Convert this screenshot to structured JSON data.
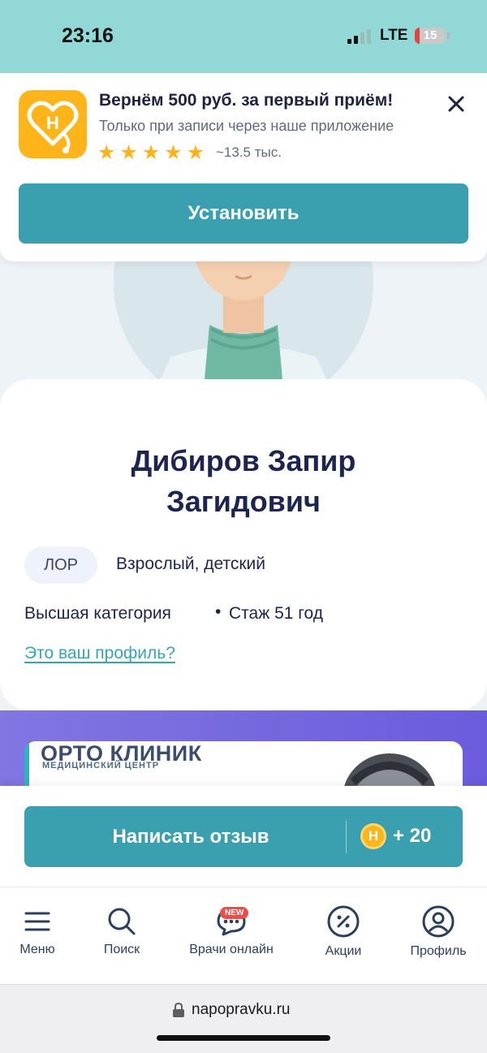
{
  "status_bar": {
    "time": "23:16",
    "network": "LTE",
    "battery_level": "15"
  },
  "app_banner": {
    "title": "Вернём 500 руб. за первый приём!",
    "subtitle": "Только при записи через наше приложение",
    "rating_stars": 5,
    "rating_count": "~13.5 тыс.",
    "install_label": "Установить",
    "icon_color": "#ffb51a"
  },
  "doctor": {
    "name": "Дибиров Запир Загидович",
    "specialty": "ЛОР",
    "age_groups": "Взрослый, детский",
    "category": "Высшая категория",
    "separator": "•",
    "experience": "Стаж 51 год",
    "profile_link": "Это ваш профиль?"
  },
  "clinic_promo": {
    "name": "ОРТО КЛИНИК",
    "subtitle": "МЕДИЦИНСКИЙ ЦЕНТР"
  },
  "review": {
    "button_label": "Написать отзыв",
    "coin_letter": "Н",
    "bonus": "+ 20"
  },
  "bottom_nav": {
    "items": [
      {
        "label": "Меню",
        "icon": "menu-icon"
      },
      {
        "label": "Поиск",
        "icon": "search-icon"
      },
      {
        "label": "Врачи онлайн",
        "icon": "chat-icon",
        "badge": "NEW"
      },
      {
        "label": "Акции",
        "icon": "percent-icon"
      },
      {
        "label": "Профиль",
        "icon": "user-icon"
      }
    ]
  },
  "browser": {
    "url": "napopravku.ru"
  },
  "colors": {
    "accent": "#3a9fae",
    "dark_text": "#1d2450",
    "promo_gradient_start": "#8176e2",
    "promo_gradient_end": "#6a5cdc"
  }
}
